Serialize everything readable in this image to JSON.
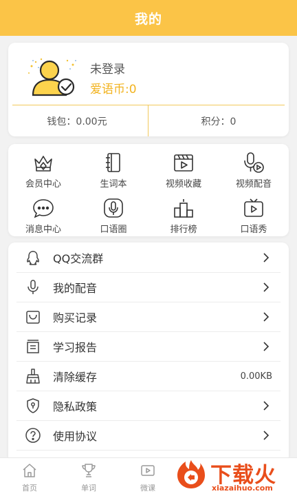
{
  "header": {
    "title": "我的"
  },
  "profile": {
    "login_status": "未登录",
    "coins": "爱语币:0",
    "wallet": "钱包：0.00元",
    "points": "积分：0"
  },
  "features": [
    {
      "label": "会员中心",
      "icon": "crown-icon"
    },
    {
      "label": "生词本",
      "icon": "notebook-icon"
    },
    {
      "label": "视频收藏",
      "icon": "video-collect-icon"
    },
    {
      "label": "视频配音",
      "icon": "video-dub-icon"
    },
    {
      "label": "消息中心",
      "icon": "message-icon"
    },
    {
      "label": "口语圈",
      "icon": "mic-circle-icon"
    },
    {
      "label": "排行榜",
      "icon": "ranking-icon"
    },
    {
      "label": "口语秀",
      "icon": "tv-icon"
    }
  ],
  "menu": [
    {
      "label": "QQ交流群",
      "icon": "qq-icon"
    },
    {
      "label": "我的配音",
      "icon": "microphone-icon"
    },
    {
      "label": "购买记录",
      "icon": "shopping-bag-icon"
    },
    {
      "label": "学习报告",
      "icon": "report-icon"
    },
    {
      "label": "清除缓存",
      "icon": "broom-icon",
      "value": "0.00KB"
    },
    {
      "label": "隐私政策",
      "icon": "shield-icon"
    },
    {
      "label": "使用协议",
      "icon": "question-icon"
    }
  ],
  "tabs": [
    {
      "label": "首页",
      "icon": "home-icon"
    },
    {
      "label": "单词",
      "icon": "trophy-icon"
    },
    {
      "label": "微课",
      "icon": "video-icon"
    }
  ],
  "watermark": {
    "title": "下载火",
    "domain": "xiazaihuo.com"
  },
  "colors": {
    "accent": "#fbc447",
    "coin": "#f2b31f",
    "watermark": "#e94e1b"
  }
}
